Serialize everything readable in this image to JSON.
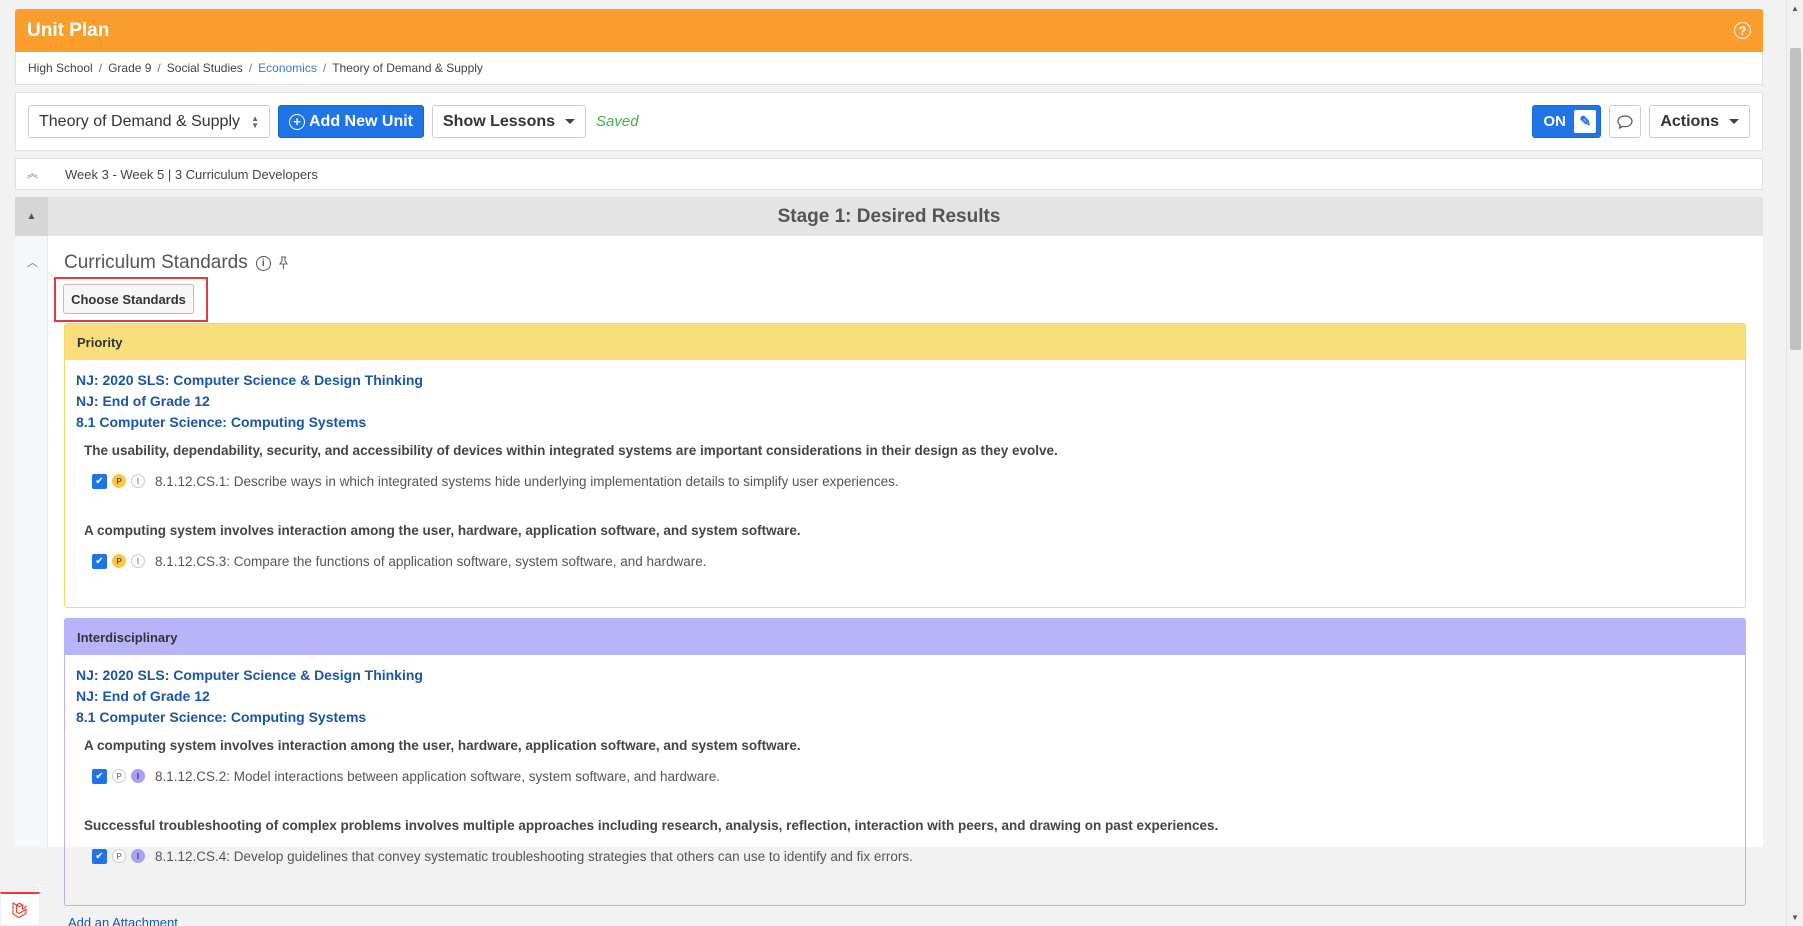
{
  "header": {
    "title": "Unit Plan",
    "help_icon": "?"
  },
  "breadcrumb": {
    "items": [
      "High School",
      "Grade 9",
      "Social Studies",
      "Economics",
      "Theory of Demand & Supply"
    ],
    "separator": "/"
  },
  "toolbar": {
    "unit_select_value": "Theory of Demand & Supply",
    "add_unit_label": "Add New Unit",
    "show_lessons_label": "Show Lessons",
    "saved_label": "Saved",
    "edit_toggle_label": "ON",
    "actions_label": "Actions"
  },
  "infobar": {
    "text": "Week 3 - Week 5 |  3 Curriculum Developers"
  },
  "stage": {
    "title": "Stage 1: Desired Results"
  },
  "section": {
    "title": "Curriculum Standards",
    "choose_button": "Choose Standards",
    "attachment_link": "Add an Attachment"
  },
  "priority": {
    "label": "Priority",
    "links": [
      "NJ: 2020 SLS: Computer Science & Design Thinking",
      "NJ: End of Grade 12",
      "8.1 Computer Science: Computing Systems"
    ],
    "cluster1": "The usability, dependability, security, and accessibility of devices within integrated systems are important considerations in their design as they evolve.",
    "std1": "8.1.12.CS.1: Describe ways in which integrated systems hide underlying implementation details to simplify user experiences.",
    "cluster2": "A computing system involves interaction among the user, hardware, application software, and system software.",
    "std2": "8.1.12.CS.3: Compare the functions of application software, system software, and hardware."
  },
  "interdisciplinary": {
    "label": "Interdisciplinary",
    "links": [
      "NJ: 2020 SLS: Computer Science & Design Thinking",
      "NJ: End of Grade 12",
      "8.1 Computer Science: Computing Systems"
    ],
    "cluster1": "A computing system involves interaction among the user, hardware, application software, and system software.",
    "std1": "8.1.12.CS.2: Model interactions between application software, system software, and hardware.",
    "cluster2": "Successful troubleshooting of complex problems involves multiple approaches including research, analysis, reflection, interaction with peers, and drawing on past experiences.",
    "std2": "8.1.12.CS.4: Develop guidelines that convey systematic troubleshooting strategies that others can use to identify and fix errors."
  },
  "badges": {
    "p": "P",
    "i": "I"
  },
  "colors": {
    "header": "#fb9d2c",
    "primary": "#1f74e8",
    "saved": "#3cb54a",
    "priority": "#f8df7c",
    "interdisciplinary": "#b9b4f9",
    "highlight": "#e0393e"
  }
}
